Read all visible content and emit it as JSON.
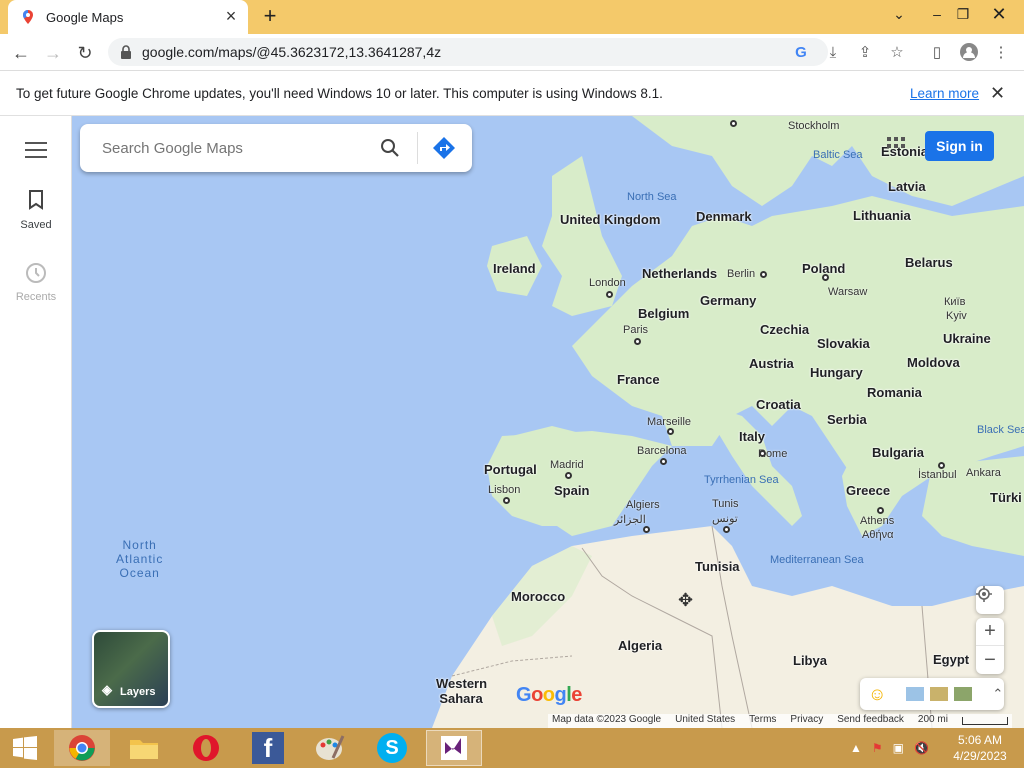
{
  "browser": {
    "tab_title": "Google Maps",
    "url": "google.com/maps/@45.3623172,13.3641287,4z",
    "window_controls": [
      "minimize",
      "restore",
      "close"
    ]
  },
  "infobar": {
    "message": "To get future Google Chrome updates, you'll need Windows 10 or later. This computer is using Windows 8.1.",
    "link": "Learn more"
  },
  "sidebar": {
    "items": [
      {
        "label": "Saved",
        "icon": "bookmark-icon",
        "enabled": true
      },
      {
        "label": "Recents",
        "icon": "history-icon",
        "enabled": false
      }
    ]
  },
  "search": {
    "placeholder": "Search Google Maps",
    "value": ""
  },
  "header": {
    "signin_label": "Sign in"
  },
  "map": {
    "countries": [
      "United Kingdom",
      "Ireland",
      "Denmark",
      "Netherlands",
      "Germany",
      "Belgium",
      "France",
      "Portugal",
      "Spain",
      "Italy",
      "Austria",
      "Czechia",
      "Poland",
      "Slovakia",
      "Hungary",
      "Croatia",
      "Serbia",
      "Romania",
      "Bulgaria",
      "Greece",
      "Moldova",
      "Ukraine",
      "Belarus",
      "Lithuania",
      "Latvia",
      "Estonia",
      "Morocco",
      "Algeria",
      "Tunisia",
      "Libya",
      "Egypt",
      "Western Sahara",
      "Türki"
    ],
    "cities": [
      "Stockholm",
      "Berlin",
      "Warsaw",
      "London",
      "Paris",
      "Marseille",
      "Barcelona",
      "Madrid",
      "Lisbon",
      "Rome",
      "Algiers",
      "الجزائر",
      "Tunis",
      "تونس",
      "Athens",
      "Αθήνα",
      "İstanbul",
      "Ankara",
      "Київ",
      "Kyiv"
    ],
    "seas": [
      "North Sea",
      "Baltic Sea",
      "Tyrrhenian Sea",
      "Mediterranean Sea",
      "Black Sea"
    ],
    "ocean": [
      "North",
      "Atlantic",
      "Ocean"
    ],
    "layers_label": "Layers",
    "logo": "Google",
    "footer": [
      "Map data ©2023 Google",
      "United States",
      "Terms",
      "Privacy",
      "Send feedback"
    ],
    "scale_label": "200 mi",
    "colors": {
      "water": "#a8c7f3",
      "land": "#d8ecc9",
      "desert": "#f3efe2",
      "accent": "#1a73e8"
    }
  },
  "taskbar": {
    "apps": [
      "start",
      "chrome",
      "file-explorer",
      "opera",
      "facebook",
      "paint",
      "skype",
      "visual-studio"
    ],
    "time": "5:06 AM",
    "date": "4/29/2023"
  }
}
